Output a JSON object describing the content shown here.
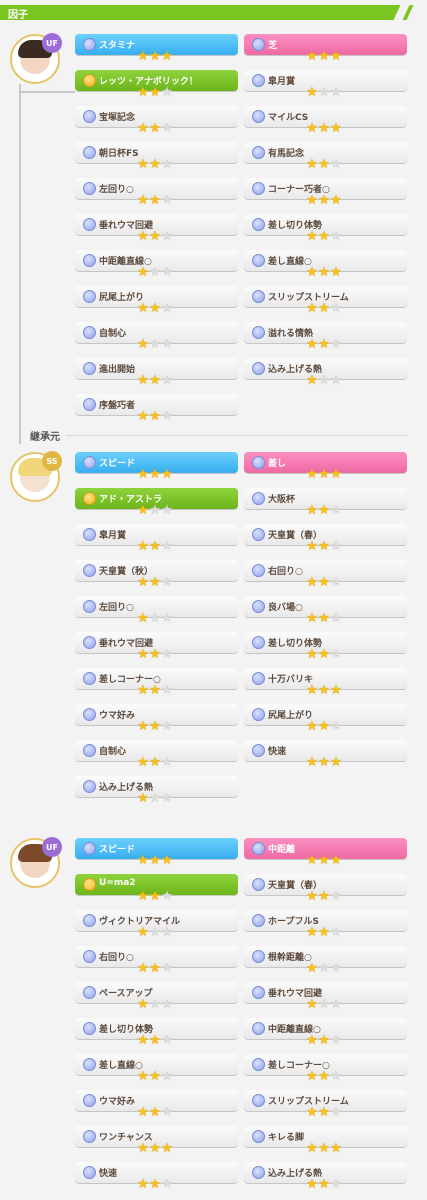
{
  "header": {
    "title": "因子"
  },
  "colors": {
    "accent_green": "#7ac51f",
    "stamina_blue": "#37aef0",
    "aptitude_pink": "#ef6aa5",
    "unique_green": "#6cb51b",
    "star": "#f6c11a"
  },
  "sections": [
    {
      "avatar": {
        "badge": "UF"
      },
      "label": "",
      "left": [
        {
          "name": "スタミナ",
          "stars": 3,
          "kind": "blue"
        },
        {
          "name": "レッツ・アナボリック！",
          "stars": 2,
          "kind": "green"
        },
        {
          "name": "宝塚記念",
          "stars": 2,
          "kind": "white"
        },
        {
          "name": "朝日杯FS",
          "stars": 2,
          "kind": "white"
        },
        {
          "name": "左回り○",
          "stars": 2,
          "kind": "white"
        },
        {
          "name": "垂れウマ回避",
          "stars": 2,
          "kind": "white"
        },
        {
          "name": "中距離直線○",
          "stars": 1,
          "kind": "white"
        },
        {
          "name": "尻尾上がり",
          "stars": 2,
          "kind": "white"
        },
        {
          "name": "自制心",
          "stars": 1,
          "kind": "white"
        },
        {
          "name": "進出開始",
          "stars": 2,
          "kind": "white"
        },
        {
          "name": "序盤巧者",
          "stars": 2,
          "kind": "white"
        }
      ],
      "right": [
        {
          "name": "芝",
          "stars": 3,
          "kind": "pink"
        },
        {
          "name": "皐月賞",
          "stars": 1,
          "kind": "white"
        },
        {
          "name": "マイルCS",
          "stars": 3,
          "kind": "white"
        },
        {
          "name": "有馬記念",
          "stars": 2,
          "kind": "white"
        },
        {
          "name": "コーナー巧者○",
          "stars": 3,
          "kind": "white"
        },
        {
          "name": "差し切り体勢",
          "stars": 2,
          "kind": "white"
        },
        {
          "name": "差し直線○",
          "stars": 3,
          "kind": "white"
        },
        {
          "name": "スリップストリーム",
          "stars": 2,
          "kind": "white"
        },
        {
          "name": "溢れる情熱",
          "stars": 2,
          "kind": "white"
        },
        {
          "name": "込み上げる熱",
          "stars": 1,
          "kind": "white"
        }
      ]
    },
    {
      "avatar": {
        "badge": "SS"
      },
      "label": "継承元",
      "left": [
        {
          "name": "スピード",
          "stars": 3,
          "kind": "blue"
        },
        {
          "name": "アド・アストラ",
          "stars": 1,
          "kind": "green"
        },
        {
          "name": "皐月賞",
          "stars": 2,
          "kind": "white"
        },
        {
          "name": "天皇賞（秋）",
          "stars": 2,
          "kind": "white"
        },
        {
          "name": "左回り○",
          "stars": 1,
          "kind": "white"
        },
        {
          "name": "垂れウマ回避",
          "stars": 2,
          "kind": "white"
        },
        {
          "name": "差しコーナー○",
          "stars": 2,
          "kind": "white"
        },
        {
          "name": "ウマ好み",
          "stars": 2,
          "kind": "white"
        },
        {
          "name": "自制心",
          "stars": 2,
          "kind": "white"
        },
        {
          "name": "込み上げる熱",
          "stars": 1,
          "kind": "white"
        }
      ],
      "right": [
        {
          "name": "差し",
          "stars": 3,
          "kind": "pink"
        },
        {
          "name": "大阪杯",
          "stars": 2,
          "kind": "white"
        },
        {
          "name": "天皇賞（春）",
          "stars": 2,
          "kind": "white"
        },
        {
          "name": "右回り○",
          "stars": 2,
          "kind": "white"
        },
        {
          "name": "良バ場○",
          "stars": 2,
          "kind": "white"
        },
        {
          "name": "差し切り体勢",
          "stars": 2,
          "kind": "white"
        },
        {
          "name": "十万バリキ",
          "stars": 3,
          "kind": "white"
        },
        {
          "name": "尻尾上がり",
          "stars": 2,
          "kind": "white"
        },
        {
          "name": "快速",
          "stars": 3,
          "kind": "white"
        }
      ]
    },
    {
      "avatar": {
        "badge": "UF"
      },
      "label": "",
      "left": [
        {
          "name": "スピード",
          "stars": 3,
          "kind": "blue"
        },
        {
          "name": "U=ma2",
          "stars": 2,
          "kind": "green"
        },
        {
          "name": "ヴィクトリアマイル",
          "stars": 1,
          "kind": "white"
        },
        {
          "name": "右回り○",
          "stars": 2,
          "kind": "white"
        },
        {
          "name": "ペースアップ",
          "stars": 1,
          "kind": "white"
        },
        {
          "name": "差し切り体勢",
          "stars": 2,
          "kind": "white"
        },
        {
          "name": "差し直線○",
          "stars": 2,
          "kind": "white"
        },
        {
          "name": "ウマ好み",
          "stars": 2,
          "kind": "white"
        },
        {
          "name": "ワンチャンス",
          "stars": 3,
          "kind": "white"
        },
        {
          "name": "快速",
          "stars": 2,
          "kind": "white"
        }
      ],
      "right": [
        {
          "name": "中距離",
          "stars": 3,
          "kind": "pink"
        },
        {
          "name": "天皇賞（春）",
          "stars": 2,
          "kind": "white"
        },
        {
          "name": "ホープフルS",
          "stars": 2,
          "kind": "white"
        },
        {
          "name": "根幹距離○",
          "stars": 1,
          "kind": "white"
        },
        {
          "name": "垂れウマ回避",
          "stars": 1,
          "kind": "white"
        },
        {
          "name": "中距離直線○",
          "stars": 2,
          "kind": "white"
        },
        {
          "name": "差しコーナー○",
          "stars": 2,
          "kind": "white"
        },
        {
          "name": "スリップストリーム",
          "stars": 2,
          "kind": "white"
        },
        {
          "name": "キレる脚",
          "stars": 3,
          "kind": "white"
        },
        {
          "name": "込み上げる熱",
          "stars": 2,
          "kind": "white"
        }
      ]
    }
  ]
}
